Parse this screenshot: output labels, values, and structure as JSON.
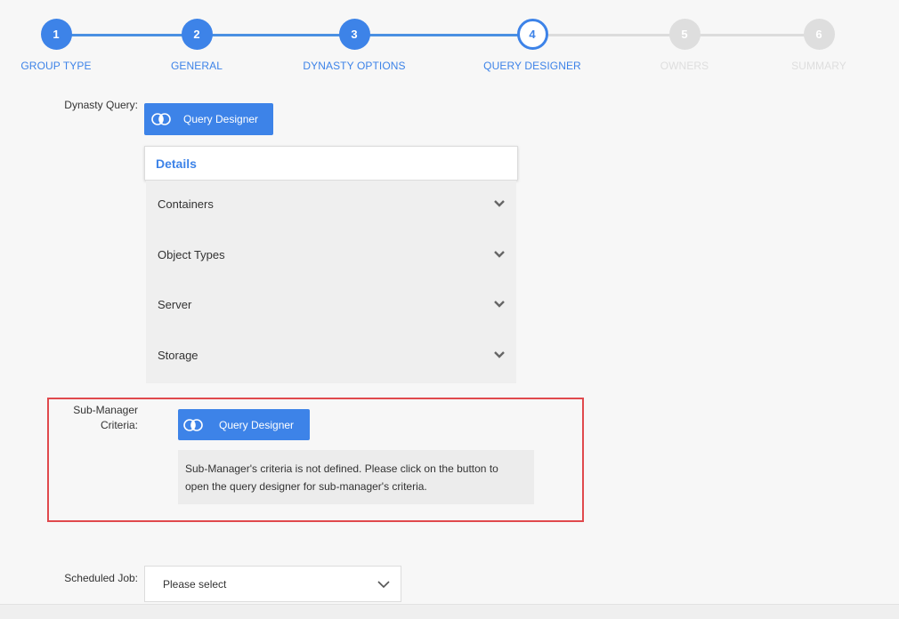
{
  "stepper": {
    "steps": [
      {
        "number": "1",
        "label": "GROUP TYPE",
        "state": "done"
      },
      {
        "number": "2",
        "label": "GENERAL",
        "state": "done"
      },
      {
        "number": "3",
        "label": "DYNASTY OPTIONS",
        "state": "done"
      },
      {
        "number": "4",
        "label": "QUERY DESIGNER",
        "state": "current"
      },
      {
        "number": "5",
        "label": "OWNERS",
        "state": "todo"
      },
      {
        "number": "6",
        "label": "SUMMARY",
        "state": "todo"
      }
    ]
  },
  "dynasty_query": {
    "label": "Dynasty Query:",
    "button_label": "Query Designer",
    "button_icon": "circles-overlap-icon"
  },
  "details": {
    "title": "Details",
    "items": [
      {
        "label": "Containers",
        "icon": "chevron-down-icon"
      },
      {
        "label": "Object Types",
        "icon": "chevron-down-icon"
      },
      {
        "label": "Server",
        "icon": "chevron-down-icon"
      },
      {
        "label": "Storage",
        "icon": "chevron-down-icon"
      }
    ]
  },
  "sub_manager": {
    "label_line1": "Sub-Manager",
    "label_line2": "Criteria:",
    "button_label": "Query Designer",
    "message_line1": "Sub-Manager's criteria is not defined. Please click on the button to",
    "message_line2": "open the query designer for sub-manager's criteria.",
    "highlight_color": "#e0494d"
  },
  "scheduled_job": {
    "label": "Scheduled Job:",
    "selected_value": "Please select"
  },
  "colors": {
    "accent": "#3d83e8",
    "inactive": "#dedede",
    "panel": "#efefef"
  }
}
